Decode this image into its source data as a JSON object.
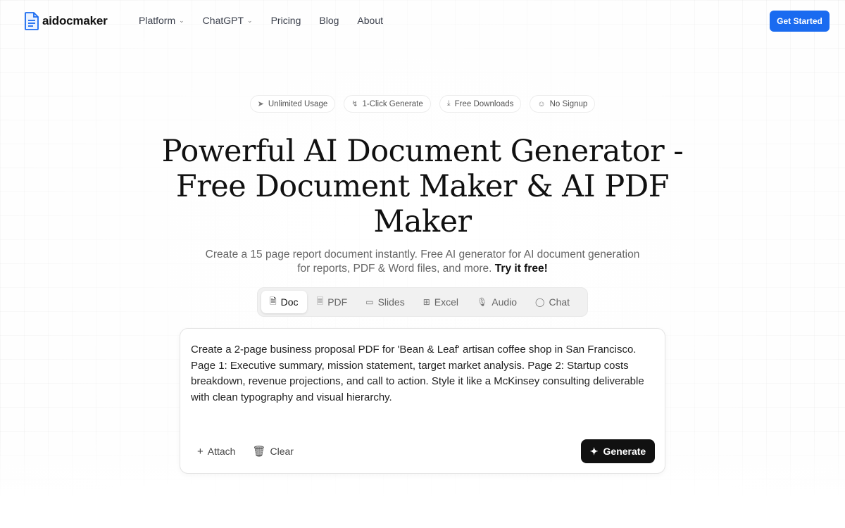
{
  "header": {
    "logo_text": "aidocmaker",
    "nav": [
      {
        "label": "Platform",
        "has_dropdown": true
      },
      {
        "label": "ChatGPT",
        "has_dropdown": true
      },
      {
        "label": "Pricing",
        "has_dropdown": false
      },
      {
        "label": "Blog",
        "has_dropdown": false
      },
      {
        "label": "About",
        "has_dropdown": false
      }
    ],
    "cta_label": "Get Started"
  },
  "badges": [
    {
      "icon": "rocket-icon",
      "label": "Unlimited Usage"
    },
    {
      "icon": "lightning-icon",
      "label": "1-Click Generate"
    },
    {
      "icon": "download-icon",
      "label": "Free Downloads"
    },
    {
      "icon": "user-icon",
      "label": "No Signup"
    }
  ],
  "hero": {
    "title": "Powerful AI Document Generator - Free Document Maker & AI PDF Maker",
    "subtitle": "Create a 15 page report document instantly. Free AI generator for AI document generation for reports, PDF & Word files, and more.",
    "subtitle_cta": "Try it free!"
  },
  "tabs": [
    {
      "icon": "document-icon",
      "label": "Doc",
      "active": true
    },
    {
      "icon": "pdf-icon",
      "label": "PDF",
      "active": false
    },
    {
      "icon": "slides-icon",
      "label": "Slides",
      "active": false
    },
    {
      "icon": "table-icon",
      "label": "Excel",
      "active": false
    },
    {
      "icon": "microphone-icon",
      "label": "Audio",
      "active": false
    },
    {
      "icon": "chat-bubble-icon",
      "label": "Chat",
      "active": false
    }
  ],
  "prompt": {
    "text": "Create a 2-page business proposal PDF for 'Bean & Leaf' artisan coffee shop in San Francisco. Page 1: Executive summary, mission statement, target market analysis. Page 2: Startup costs breakdown, revenue projections, and call to action. Style it like a McKinsey consulting deliverable with clean typography and visual hierarchy.",
    "attach_label": "Attach",
    "clear_label": "Clear",
    "generate_label": "Generate"
  },
  "colors": {
    "accent": "#1a6bf0",
    "generate_button": "#111111"
  }
}
